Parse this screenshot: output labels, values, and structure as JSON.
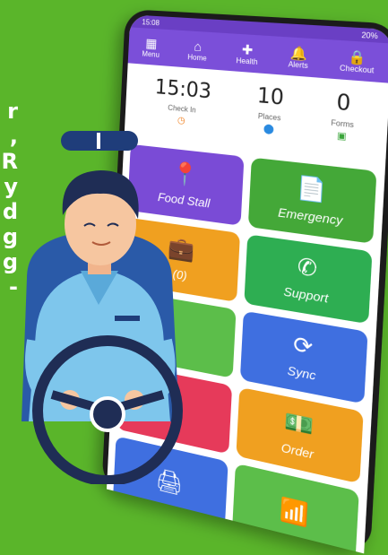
{
  "status": {
    "time": "15:08",
    "battery": "20%"
  },
  "nav": [
    {
      "label": "Menu",
      "icon": "menu-icon",
      "glyph": "▦"
    },
    {
      "label": "Home",
      "icon": "home-icon",
      "glyph": "⌂"
    },
    {
      "label": "Health",
      "icon": "health-icon",
      "glyph": "✚"
    },
    {
      "label": "Alerts",
      "icon": "bell-icon",
      "glyph": "🔔"
    },
    {
      "label": "Checkout",
      "icon": "lock-icon",
      "glyph": "🔒"
    }
  ],
  "stats": [
    {
      "value": "15:03",
      "label": "Check In",
      "icon": "clock-icon",
      "color": "#f08020"
    },
    {
      "value": "10",
      "label": "Places",
      "icon": "location-icon",
      "color": "#2a8ae0"
    },
    {
      "value": "0",
      "label": "Forms",
      "icon": "form-icon",
      "color": "#3aa53a"
    }
  ],
  "tiles": [
    {
      "label": "Food Stall",
      "color": "#7a4bd6",
      "glyph": "📍",
      "icon": "location-icon"
    },
    {
      "label": "Emergency",
      "color": "#44a838",
      "glyph": "📄",
      "icon": "document-icon"
    },
    {
      "label": "(0)",
      "color": "#f0a020",
      "glyph": "💼",
      "icon": "briefcase-icon"
    },
    {
      "label": "Support",
      "color": "#2eae52",
      "glyph": "✆",
      "icon": "whatsapp-icon"
    },
    {
      "label": "",
      "color": "#5cbe4a",
      "glyph": "",
      "icon": "blank-icon"
    },
    {
      "label": "Sync",
      "color": "#3f6fe0",
      "glyph": "⟳",
      "icon": "sync-icon"
    },
    {
      "label": "",
      "color": "#e63a5a",
      "glyph": "",
      "icon": "blank-icon"
    },
    {
      "label": "Order",
      "color": "#f0a020",
      "glyph": "💵",
      "icon": "money-icon"
    },
    {
      "label": "",
      "color": "#3f6fe0",
      "glyph": "🖨",
      "icon": "printer-icon"
    },
    {
      "label": "",
      "color": "#5cbe4a",
      "glyph": "📶",
      "icon": "wifi-icon"
    }
  ],
  "edge_text": [
    "r",
    ",",
    "R",
    "",
    "y",
    "d",
    "g",
    "g",
    "-"
  ]
}
